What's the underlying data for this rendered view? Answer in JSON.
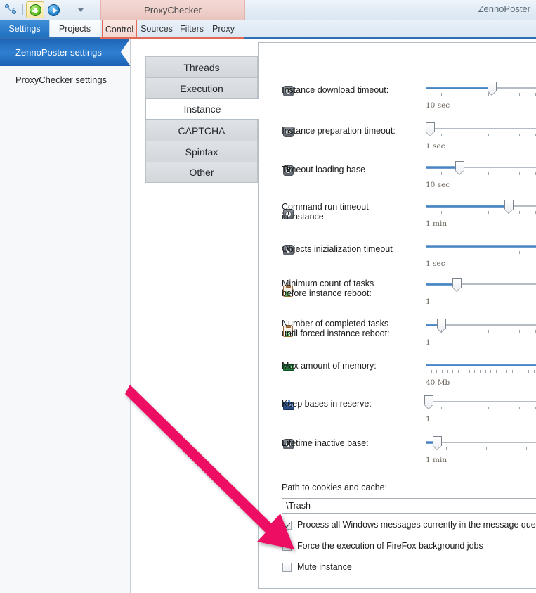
{
  "toolbar": {
    "network_icon": "network-share-icon",
    "add_icon": "add-green-plus-icon",
    "run_icon": "run-play-icon",
    "overflow_dots": "··",
    "dropdown_icon": "chevron-down-icon"
  },
  "window": {
    "project_title": "ProxyChecker",
    "app_name": "ZennoPoster"
  },
  "tabs": {
    "main": [
      {
        "label": "Settings",
        "selected": true
      },
      {
        "label": "Projects",
        "selected": false
      }
    ],
    "project": [
      {
        "label": "Control",
        "selected": true
      },
      {
        "label": "Sources",
        "selected": false
      },
      {
        "label": "Filters",
        "selected": false
      },
      {
        "label": "Proxy",
        "selected": false
      }
    ]
  },
  "sidebar": {
    "items": [
      {
        "label": "ZennoPoster settings",
        "selected": true
      },
      {
        "label": "ProxyChecker settings",
        "selected": false
      }
    ]
  },
  "category_tabs": [
    {
      "label": "Threads",
      "selected": false
    },
    {
      "label": "Execution",
      "selected": false
    },
    {
      "label": "Instance",
      "selected": true
    },
    {
      "label": "CAPTCHA",
      "selected": false
    },
    {
      "label": "Spintax",
      "selected": false
    },
    {
      "label": "Other",
      "selected": false
    }
  ],
  "settings": [
    {
      "label": "Instance download timeout:",
      "icon": "clock-icon",
      "value_text": "10 sec",
      "thumb_pct": 47,
      "fill_pct": 47,
      "ticks": 9,
      "label_lines": 1
    },
    {
      "label": "Instance preparation timeout:",
      "icon": "clock-icon",
      "value_text": "1 sec",
      "thumb_pct": 3,
      "fill_pct": 3,
      "ticks": 9,
      "label_lines": 1
    },
    {
      "label": "Timeout loading base",
      "icon": "clock-icon",
      "value_text": "10 sec",
      "thumb_pct": 24,
      "fill_pct": 24,
      "ticks": 9,
      "label_lines": 1
    },
    {
      "label": "Command run timeout\nin instance:",
      "icon": "clock-icon",
      "value_text": "1 min",
      "thumb_pct": 59,
      "fill_pct": 59,
      "ticks": 9,
      "label_lines": 2
    },
    {
      "label": "Objects inizialization timeout",
      "icon": "clock-icon",
      "value_text": "1 sec",
      "thumb_pct": 100,
      "fill_pct": 100,
      "ticks": 3,
      "label_lines": 1
    },
    {
      "label": "Minimum count of tasks\nbefore instance reboot:",
      "icon": "clipboard-checklist-icon",
      "value_text": "1",
      "thumb_pct": 22,
      "fill_pct": 22,
      "ticks": 1,
      "label_lines": 2
    },
    {
      "label": "Number of completed tasks\nuntil forced instance reboot:",
      "icon": "clipboard-checklist-icon",
      "value_text": "1",
      "thumb_pct": 11,
      "fill_pct": 11,
      "ticks": 9,
      "label_lines": 2
    },
    {
      "label": "Max amount of memory:",
      "icon": "memory-ram-icon",
      "value_text": "40 Mb",
      "thumb_pct": 93,
      "fill_pct": 93,
      "ticks": 26,
      "label_lines": 1
    },
    {
      "label": "Keep bases in reserve:",
      "icon": "counter-359-icon",
      "icon_text": "359",
      "value_text": "1",
      "thumb_pct": 2,
      "fill_pct": 0,
      "ticks": 9,
      "label_lines": 1
    },
    {
      "label": "Lifetime inactive base:",
      "icon": "clock-icon",
      "value_text": "1 min",
      "thumb_pct": 8,
      "fill_pct": 8,
      "ticks": 7,
      "label_lines": 1
    }
  ],
  "path_field": {
    "label": "Path to cookies and cache:",
    "value": "\\Trash",
    "placeholder": "Path to cookies and cache"
  },
  "checkboxes": [
    {
      "label": "Process all Windows messages currently in the message queue",
      "checked": true
    },
    {
      "label": "Force the execution of FireFox background jobs",
      "checked": false
    },
    {
      "label": "Mute instance",
      "checked": false
    }
  ],
  "annotation": {
    "type": "arrow",
    "color": "#ED1164",
    "points_to": "Force the execution of FireFox background jobs"
  }
}
